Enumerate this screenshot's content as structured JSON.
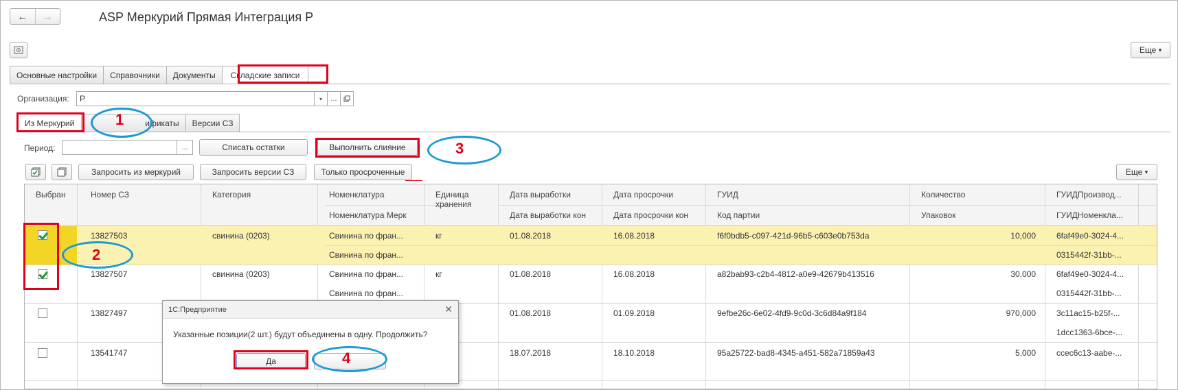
{
  "window": {
    "title": "ASP Меркурий Прямая Интеграция Р",
    "back_icon": "arrow-left-icon",
    "forward_icon": "arrow-right-icon",
    "more_label": "Еще"
  },
  "main_tabs": [
    {
      "label": "Основные настройки"
    },
    {
      "label": "Справочники"
    },
    {
      "label": "Документы"
    },
    {
      "label": "Складские записи"
    }
  ],
  "organization": {
    "label": "Организация:",
    "value": "Р"
  },
  "sub_tabs": [
    {
      "label": "Из Меркурий"
    },
    {
      "label": "ификаты"
    },
    {
      "label": "Версии СЗ"
    }
  ],
  "toolbar": {
    "period_label": "Период:",
    "period_value": "",
    "writeoff_label": "Списать остатки",
    "merge_label": "Выполнить слияние",
    "request_mercury_label": "Запросить из меркурий",
    "request_versions_label": "Запросить версии СЗ",
    "expired_only_label": "Только просроченные",
    "more_label": "Еще"
  },
  "table": {
    "headers_top": [
      "Выбран",
      "Номер СЗ",
      "Категория",
      "Номенклатура",
      "Единица хранения",
      "Дата выработки",
      "Дата просрочки",
      "ГУИД",
      "Количество",
      "ГУИДПроизвод..."
    ],
    "headers_bottom": [
      "",
      "",
      "",
      "Номенклатура Мерк",
      "",
      "Дата выработки кон",
      "Дата просрочки кон",
      "Код партии",
      "Упаковок",
      "ГУИДНоменкла..."
    ],
    "rows": [
      {
        "checked": true,
        "number": "13827503",
        "category": "свинина (0203)",
        "nom": "Свинина по фран...",
        "nom_merc": "Свинина по фран...",
        "unit": "кг",
        "prod_date": "01.08.2018",
        "exp_date": "16.08.2018",
        "guid": "f6f0bdb5-c097-421d-96b5-c603e0b753da",
        "qty": "10,000",
        "guid_prod": "6faf49e0-3024-4...",
        "guid_nom": "0315442f-31bb-..."
      },
      {
        "checked": true,
        "number": "13827507",
        "category": "свинина (0203)",
        "nom": "Свинина по фран...",
        "nom_merc": "Свинина по фран...",
        "unit": "кг",
        "prod_date": "01.08.2018",
        "exp_date": "16.08.2018",
        "guid": "a82bab93-c2b4-4812-a0e9-42679b413516",
        "qty": "30,000",
        "guid_prod": "6faf49e0-3024-4...",
        "guid_nom": "0315442f-31bb-..."
      },
      {
        "checked": false,
        "number": "13827497",
        "category": "",
        "nom": "",
        "nom_merc": "",
        "unit": "",
        "prod_date": "01.08.2018",
        "exp_date": "01.09.2018",
        "guid": "9efbe26c-6e02-4fd9-9c0d-3c6d84a9f184",
        "qty": "970,000",
        "guid_prod": "3c11ac15-b25f-...",
        "guid_nom": "1dcc1363-6bce-..."
      },
      {
        "checked": false,
        "number": "13541747",
        "category": "",
        "nom": "",
        "nom_merc": "",
        "unit": "",
        "prod_date": "18.07.2018",
        "exp_date": "18.10.2018",
        "guid": "95a25722-bad8-4345-a451-582a71859a43",
        "qty": "5,000",
        "guid_prod": "ccec6c13-aabe-...",
        "guid_nom": ""
      }
    ]
  },
  "dialog": {
    "title": "1С:Предприятие",
    "message": "Указанные позиции(2 шт.) будут объединены в одну. Продолжить?",
    "yes_label": "Да",
    "no_label": ""
  },
  "annotations": {
    "n1": "1",
    "n2": "2",
    "n3": "3",
    "n4": "4",
    "highlight_color": "#e0001a",
    "ellipse_color": "#1a9ad6"
  },
  "colors": {
    "selected_row": "#fbf1b0",
    "checkbox_cell": "#f3d526"
  }
}
